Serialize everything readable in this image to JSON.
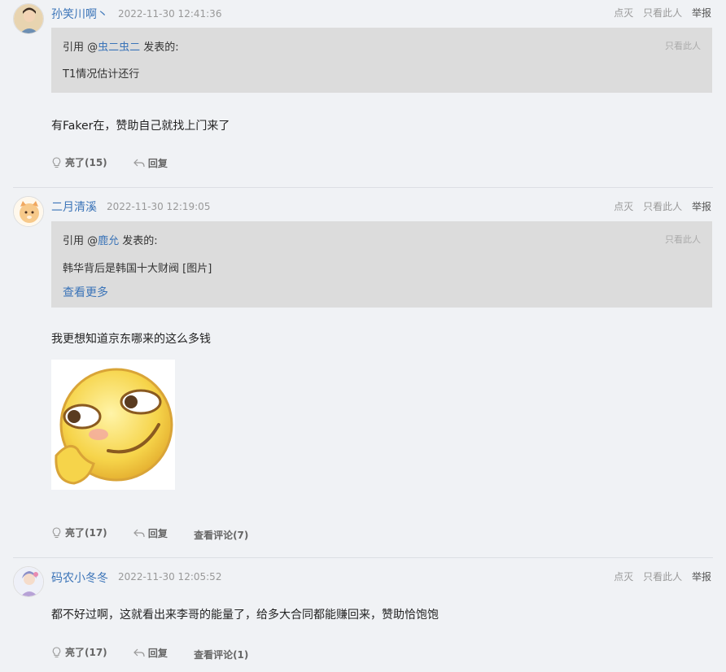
{
  "colors": {
    "link": "#3b74b8",
    "quote_bg": "#dcdcdc",
    "page_bg": "#f0f2f5"
  },
  "actions": {
    "dim": "点灭",
    "only_this": "只看此人",
    "report": "举报"
  },
  "posts": [
    {
      "username": "孙笑川啊丶",
      "time": "2022-11-30 12:41:36",
      "quote": {
        "prefix": "引用 @",
        "author": "虫二虫二",
        "suffix": " 发表的:",
        "only_this": "只看此人",
        "text": "T1情况估计还行"
      },
      "content": "有Faker在，赞助自己就找上门来了",
      "like": "亮了(15)",
      "reply": "回复"
    },
    {
      "username": "二月清溪",
      "time": "2022-11-30 12:19:05",
      "quote": {
        "prefix": "引用 @",
        "author": "鹿允",
        "suffix": " 发表的:",
        "only_this": "只看此人",
        "text": "韩华背后是韩国十大财阀 [图片]",
        "more": "查看更多"
      },
      "content": "我更想知道京东哪来的这么多钱",
      "like": "亮了(17)",
      "reply": "回复",
      "comments": "查看评论(7)"
    },
    {
      "username": "码农小冬冬",
      "time": "2022-11-30 12:05:52",
      "content": "都不好过啊，这就看出来李哥的能量了，给多大合同都能赚回来，赞助恰饱饱",
      "like": "亮了(17)",
      "reply": "回复",
      "comments": "查看评论(1)"
    }
  ]
}
